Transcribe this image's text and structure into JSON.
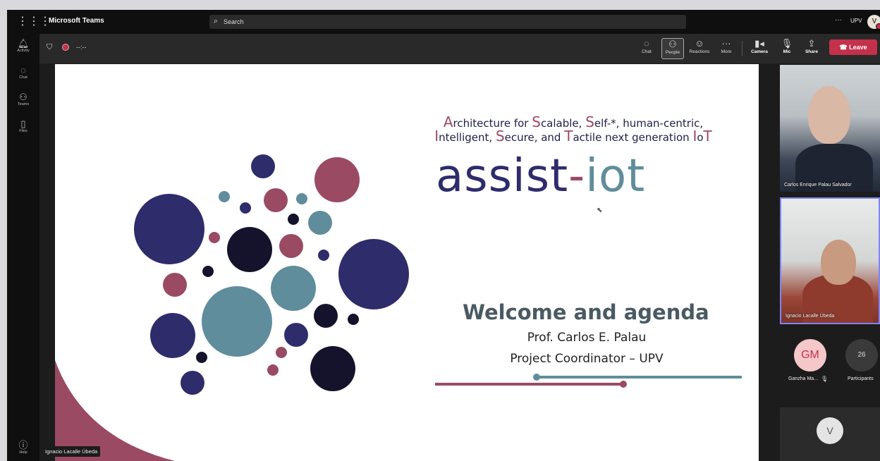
{
  "app": {
    "title": "Microsoft Teams",
    "search_placeholder": "Search",
    "more_label": "···",
    "org_label": "UPV",
    "user_initial": "V"
  },
  "rail": [
    {
      "label": "Activity",
      "icon": "bell-icon"
    },
    {
      "label": "Chat",
      "icon": "chat-icon"
    },
    {
      "label": "Teams",
      "icon": "teams-icon"
    },
    {
      "label": "Files",
      "icon": "file-icon"
    },
    {
      "label": "Help",
      "icon": "help-icon"
    }
  ],
  "meeting": {
    "timer": "--:--",
    "controls": [
      {
        "label": "Chat",
        "icon": "chat-icon"
      },
      {
        "label": "People",
        "icon": "people-icon"
      },
      {
        "label": "Reactions",
        "icon": "reactions-icon"
      },
      {
        "label": "More",
        "icon": "more-icon"
      },
      {
        "label": "Camera",
        "icon": "camera-off-icon"
      },
      {
        "label": "Mic",
        "icon": "mic-off-icon"
      },
      {
        "label": "Share",
        "icon": "share-icon"
      }
    ],
    "leave_label": "Leave"
  },
  "slide": {
    "subtitle_line1": [
      {
        "t": "A",
        "b": true
      },
      {
        "t": "rchitecture for ",
        "b": false
      },
      {
        "t": "S",
        "b": true
      },
      {
        "t": "calable, ",
        "b": false
      },
      {
        "t": "S",
        "b": true
      },
      {
        "t": "elf-*, human-centric,",
        "b": false
      }
    ],
    "subtitle_line2": [
      {
        "t": "I",
        "b": true
      },
      {
        "t": "ntelligent, ",
        "b": false
      },
      {
        "t": "S",
        "b": true
      },
      {
        "t": "ecure, and ",
        "b": false
      },
      {
        "t": "T",
        "b": true
      },
      {
        "t": "actile next generation ",
        "b": false
      },
      {
        "t": "I",
        "b": true
      },
      {
        "t": "o",
        "b": false
      },
      {
        "t": "T",
        "b": true
      }
    ],
    "logo_part1": "assist",
    "logo_part2": "-",
    "logo_part3": "iot",
    "heading": "Welcome and agenda",
    "presenter": "Prof. Carlos E. Palau",
    "role": "Project Coordinator – UPV",
    "colors": {
      "navy": "#2e2c6b",
      "maroon": "#9a4a63",
      "teal": "#5f8d9c",
      "dark": "#15132b"
    }
  },
  "presenter_tag": "Ignacio Lacalle Úbeda",
  "participants": {
    "tile1_name": "Carlos Enrique Palau Salvador",
    "tile2_name": "Ignacio Lacalle Úbeda",
    "gm_initials": "GM",
    "gm_name": "Ganzha Ma...",
    "count": "26",
    "count_label": "Participants",
    "self_initial": "V"
  }
}
